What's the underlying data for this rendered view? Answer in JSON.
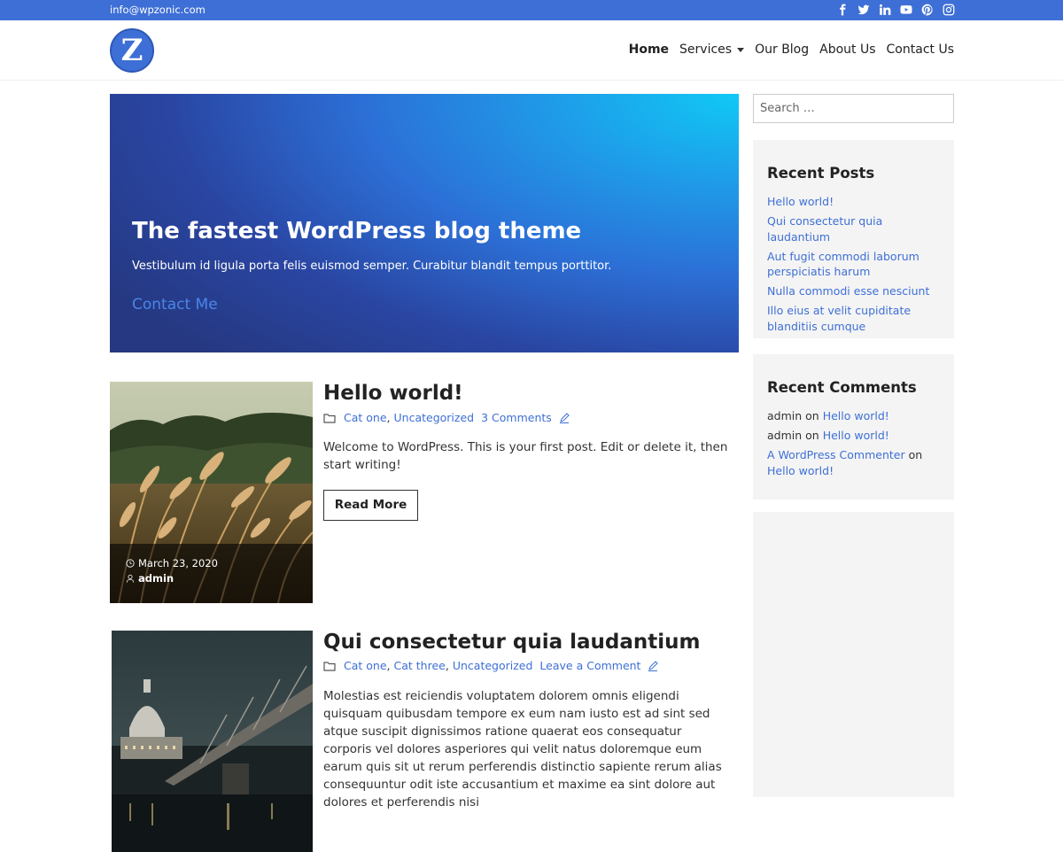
{
  "topbar": {
    "email": "info@wpzonic.com",
    "social": [
      "facebook-icon",
      "twitter-icon",
      "linkedin-icon",
      "youtube-icon",
      "pinterest-icon",
      "instagram-icon"
    ],
    "color": "#3e6fd6"
  },
  "header": {
    "logo_letter": "Z",
    "nav": [
      {
        "label": "Home",
        "active": true
      },
      {
        "label": "Services",
        "has_dropdown": true
      },
      {
        "label": "Our Blog"
      },
      {
        "label": "About Us"
      },
      {
        "label": "Contact Us"
      }
    ]
  },
  "hero": {
    "title": "The fastest WordPress blog theme",
    "subtitle": "Vestibulum id ligula porta felis euismod semper. Curabitur blandit tempus porttitor.",
    "cta": "Contact Me"
  },
  "posts": [
    {
      "title": "Hello world!",
      "categories": [
        "Cat one",
        "Uncategorized"
      ],
      "comments": "3 Comments",
      "excerpt": "Welcome to WordPress. This is your first post. Edit or delete it, then start writing!",
      "read_more": "Read More",
      "date": "March 23, 2020",
      "author": "admin",
      "image": "wheat-field-photo"
    },
    {
      "title": "Qui consectetur quia laudantium",
      "categories": [
        "Cat one",
        "Cat three",
        "Uncategorized"
      ],
      "comments": "Leave a Comment",
      "excerpt": "Molestias est reiciendis voluptatem dolorem omnis eligendi quisquam quibusdam tempore ex eum nam iusto est ad sint sed atque suscipit dignissimos ratione quaerat eos consequatur corporis vel dolores asperiores qui velit natus doloremque eum earum quis sit ut rerum perferendis distinctio sapiente rerum alias consequuntur odit iste accusantium et maxime ea sint dolore aut dolores et perferendis nisi",
      "image": "city-bridge-night-photo"
    }
  ],
  "sidebar": {
    "search_placeholder": "Search …",
    "recent_posts": {
      "title": "Recent Posts",
      "items": [
        "Hello world!",
        "Qui consectetur quia laudantium",
        "Aut fugit commodi laborum perspiciatis harum",
        "Nulla commodi esse nesciunt",
        "Illo eius at velit cupiditate blanditiis cumque"
      ]
    },
    "recent_comments": {
      "title": "Recent Comments",
      "items": [
        {
          "author": "admin",
          "on": "on",
          "post": "Hello world!"
        },
        {
          "author": "admin",
          "on": "on",
          "post": "Hello world!"
        },
        {
          "author": "A WordPress Commenter",
          "on": "on",
          "post": "Hello world!"
        }
      ]
    }
  }
}
